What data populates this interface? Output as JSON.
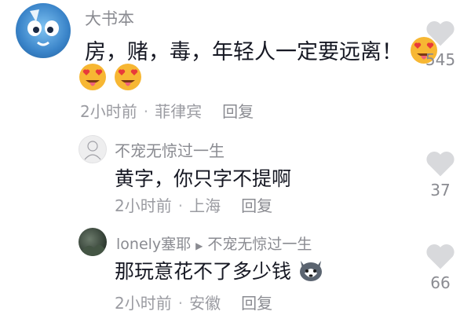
{
  "comments": [
    {
      "username": "大书本",
      "text": "房，赌，毒，年轻人一定要远离！",
      "time": "2小时前",
      "location": "菲律宾",
      "reply_label": "回复",
      "likes": "545",
      "emoji_name": "heart-eyes-tongue-emoji",
      "avatar_icon": "blue-creature-avatar"
    },
    {
      "username": "不宠无惊过一生",
      "text": "黄字，你只字不提啊",
      "time": "2小时前",
      "location": "上海",
      "reply_label": "回复",
      "likes": "37",
      "avatar_icon": "sketch-avatar"
    },
    {
      "username": "lonely塞耶",
      "reply_to": "不宠无惊过一生",
      "text": "那玩意花不了多少钱",
      "time": "2小时前",
      "location": "安徽",
      "reply_label": "回复",
      "likes": "66",
      "emoji_name": "husky-dog-emoji",
      "avatar_icon": "dark-photo-avatar"
    }
  ],
  "colors": {
    "text": "#161823",
    "meta": "#9a9ba1",
    "heart": "#d8d9dc"
  }
}
